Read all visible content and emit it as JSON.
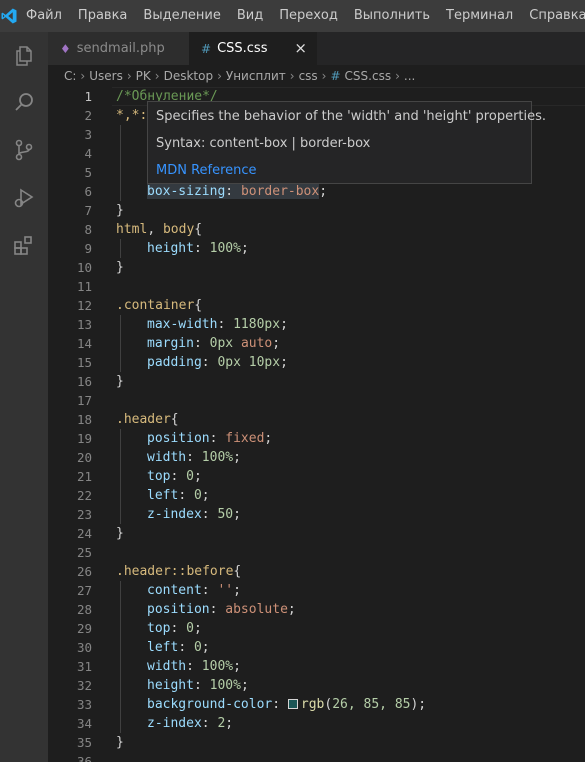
{
  "menubar": {
    "logo_icon": "vscode-logo-icon",
    "items": [
      "Файл",
      "Правка",
      "Выделение",
      "Вид",
      "Переход",
      "Выполнить",
      "Терминал",
      "Справка"
    ]
  },
  "activitybar": {
    "icons": [
      "explorer-icon",
      "search-icon",
      "source-control-icon",
      "run-debug-icon",
      "extensions-icon"
    ]
  },
  "tabs": [
    {
      "label": "sendmail.php",
      "icon": "php-file-icon",
      "active": false
    },
    {
      "label": "CSS.css",
      "icon": "css-file-icon",
      "active": true,
      "close": "×"
    }
  ],
  "breadcrumb": {
    "parts": [
      "C:",
      "Users",
      "PK",
      "Desktop",
      "Унисплит",
      "css"
    ],
    "file_icon": "#",
    "file": "CSS.css",
    "more": "..."
  },
  "editor": {
    "current_line": 1,
    "line_numbers": [
      "1",
      "2",
      "3",
      "4",
      "5",
      "6",
      "7",
      "8",
      "9",
      "10",
      "11",
      "12",
      "13",
      "14",
      "15",
      "16",
      "17",
      "18",
      "19",
      "20",
      "21",
      "22",
      "23",
      "24",
      "25",
      "26",
      "27",
      "28",
      "29",
      "30",
      "31",
      "32",
      "33",
      "34",
      "35",
      "36"
    ],
    "code": {
      "l1": "/*Обнуление*/",
      "l2_sel": "*,*:",
      "l6_prop": "box-sizing",
      "l6_val": "border-box",
      "l8_sel1": "html",
      "l8_sel2": "body",
      "l9_prop": "height",
      "l9_val": "100%",
      "l12_sel": ".container",
      "l13_prop": "max-width",
      "l13_val": "1180px",
      "l14_prop": "margin",
      "l14_val1": "0px",
      "l14_val2": "auto",
      "l15_prop": "padding",
      "l15_val1": "0px",
      "l15_val2": "10px",
      "l18_sel": ".header",
      "l19_prop": "position",
      "l19_val": "fixed",
      "l20_prop": "width",
      "l20_val": "100%",
      "l21_prop": "top",
      "l21_val": "0",
      "l22_prop": "left",
      "l22_val": "0",
      "l23_prop": "z-index",
      "l23_val": "50",
      "l26_sel": ".header::before",
      "l27_prop": "content",
      "l27_val": "''",
      "l28_prop": "position",
      "l28_val": "absolute",
      "l29_prop": "top",
      "l29_val": "0",
      "l30_prop": "left",
      "l30_val": "0",
      "l31_prop": "width",
      "l31_val": "100%",
      "l32_prop": "height",
      "l32_val": "100%",
      "l33_prop": "background-color",
      "l33_fn": "rgb",
      "l33_args": "26, 85, 85",
      "l33_swatch": "#1a5555",
      "l34_prop": "z-index",
      "l34_val": "2"
    }
  },
  "hover": {
    "description": "Specifies the behavior of the 'width' and 'height' properties.",
    "syntax": "Syntax: content-box | border-box",
    "link": "MDN Reference"
  },
  "colors": {
    "menubar_bg": "#3c3c3c",
    "activitybar_bg": "#333333",
    "editor_bg": "#1e1e1e",
    "link": "#3794ff"
  }
}
